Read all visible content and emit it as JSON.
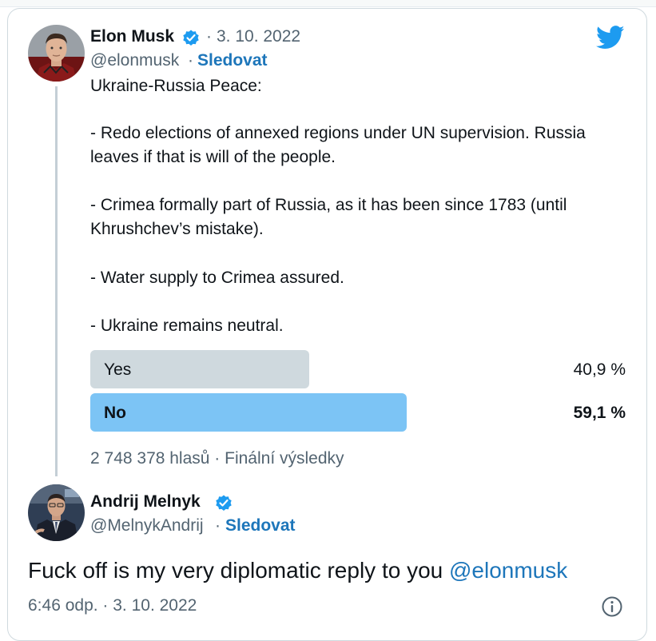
{
  "colors": {
    "accent": "#1d9bf0",
    "link": "#1d76ba",
    "poll_winner": "#7cc4f5",
    "poll_other": "#cfd9de",
    "muted": "#536471"
  },
  "icons": {
    "logo": "twitter-bird-icon",
    "verified": "verified-badge-icon",
    "info": "info-icon"
  },
  "tweet": {
    "author_name": "Elon Musk",
    "date": "3. 10. 2022",
    "date_sep": "·",
    "handle": "@elonmusk",
    "handle_sep": "·",
    "follow_label": "Sledovat",
    "lines": [
      "Ukraine-Russia Peace:",
      "- Redo elections of annexed regions under UN supervision. Russia",
      "leaves if that is will of the people.",
      "- Crimea formally part of Russia, as it has been since 1783 (until",
      "Khrushchev’s mistake).",
      "- Water supply to Crimea assured.",
      "- Ukraine remains neutral."
    ],
    "poll": {
      "options": [
        {
          "label": "Yes",
          "percent_text": "40,9 %",
          "fraction": 0.409,
          "winner": false
        },
        {
          "label": "No",
          "percent_text": "59,1 %",
          "fraction": 0.591,
          "winner": true
        }
      ],
      "footer": "2 748 378 hlasů · Finální výsledky"
    }
  },
  "reply": {
    "author_name": "Andrij Melnyk",
    "handle": "@MelnykAndrij",
    "handle_sep": "·",
    "follow_label": "Sledovat",
    "text_before": "Fuck off is my very diplomatic reply to you ",
    "mention": "@elonmusk",
    "timestamp": "6:46 odp. · 3. 10. 2022"
  }
}
